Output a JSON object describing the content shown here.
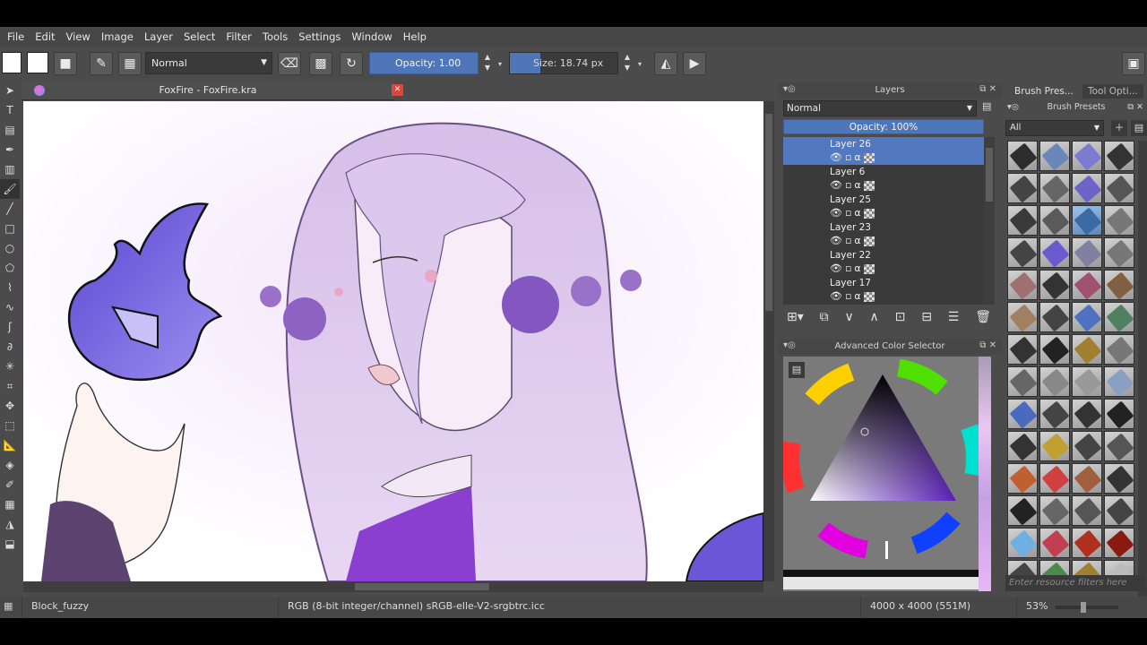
{
  "menu": [
    "File",
    "Edit",
    "View",
    "Image",
    "Layer",
    "Select",
    "Filter",
    "Tools",
    "Settings",
    "Window",
    "Help"
  ],
  "toolbar": {
    "blend_mode": "Normal",
    "opacity_label": "Opacity:  1.00",
    "size_label": "Size:  18.74 px"
  },
  "document": {
    "tab_title": "FoxFire - FoxFire.kra",
    "close_glyph": "✕"
  },
  "layers_panel": {
    "title": "Layers",
    "blend_mode": "Normal",
    "opacity": "Opacity:  100%",
    "layers": [
      {
        "name": "Layer 26",
        "selected": true
      },
      {
        "name": "Layer 6",
        "selected": false
      },
      {
        "name": "Layer 25",
        "selected": false
      },
      {
        "name": "Layer 23",
        "selected": false
      },
      {
        "name": "Layer 22",
        "selected": false
      },
      {
        "name": "Layer 17",
        "selected": false
      }
    ]
  },
  "color_selector": {
    "title": "Advanced Color Selector",
    "accent": "#5a1fb8"
  },
  "brush_presets": {
    "tab_label": "Brush Pres...",
    "tab2_label": "Tool Opti...",
    "header": "Brush Presets",
    "filter": "All",
    "search_placeholder": "Enter resource filters here"
  },
  "status": {
    "brush_name": "Block_fuzzy",
    "color_profile": "RGB (8-bit integer/channel)  sRGB-elle-V2-srgbtrc.icc",
    "image_size": "4000 x 4000 (551M)",
    "zoom": "53%"
  }
}
